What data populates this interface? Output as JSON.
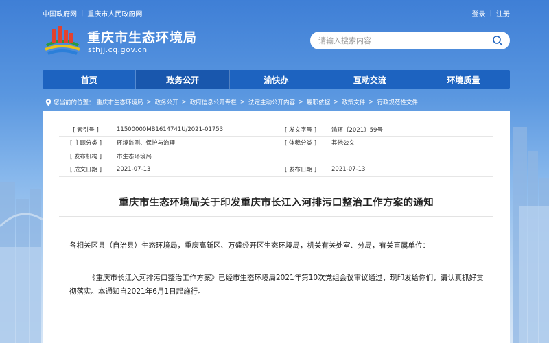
{
  "top_links": [
    "中国政府网",
    "重庆市人民政府网"
  ],
  "top_links_sep": "|",
  "account": {
    "login": "登录",
    "sep": "|",
    "register": "注册"
  },
  "header": {
    "title": "重庆市生态环境局",
    "domain": "sthjj.cq.gov.cn"
  },
  "search": {
    "placeholder": "请输入搜索内容",
    "icon": "search-icon"
  },
  "nav": {
    "items": [
      {
        "label": "首页"
      },
      {
        "label": "政务公开"
      },
      {
        "label": "渝快办"
      },
      {
        "label": "互动交流"
      },
      {
        "label": "环境质量"
      }
    ],
    "active_index": 1
  },
  "breadcrumb": {
    "prefix": "您当前的位置：",
    "sep": ">",
    "items": [
      "重庆市生态环境局",
      "政务公开",
      "政府信息公开专栏",
      "法定主动公开内容",
      "履职依据",
      "政策文件",
      "行政规范性文件"
    ]
  },
  "meta": {
    "rows": [
      {
        "k1": "[ 索引号 ]",
        "v1": "11500000MB1614741U/2021-01753",
        "k2": "[ 发文字号 ]",
        "v2": "渝环〔2021〕59号"
      },
      {
        "k1": "[ 主题分类 ]",
        "v1": "环境监测、保护与治理",
        "k2": "[ 体裁分类 ]",
        "v2": "其他公文"
      },
      {
        "k1": "[ 发布机构 ]",
        "v1": "市生态环境局",
        "k2": "",
        "v2": ""
      },
      {
        "k1": "[ 成文日期 ]",
        "v1": "2021-07-13",
        "k2": "[ 发布日期 ]",
        "v2": "2021-07-13"
      }
    ]
  },
  "document": {
    "title": "重庆市生态环境局关于印发重庆市长江入河排污口整治工作方案的通知",
    "salutation": "各相关区县（自治县）生态环境局，重庆高新区、万盛经开区生态环境局，机关有关处室、分局，有关直属单位：",
    "body": "《重庆市长江入河排污口整治工作方案》已经市生态环境局2021年第10次党组会议审议通过，现印发给你们，请认真抓好贯彻落实。本通知自2021年6月1日起施行。"
  },
  "colors": {
    "nav": "#1d63c0",
    "nav_active": "#1957ad",
    "sky_top": "#3f7fd6"
  }
}
